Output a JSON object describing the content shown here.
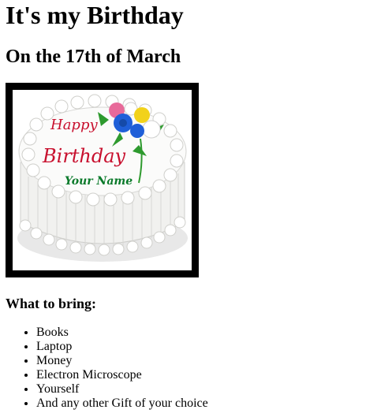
{
  "page": {
    "title": "It's my Birthday",
    "subtitle": "On the 17th of March",
    "image": {
      "alt": "Birthday cake",
      "cake_text_line1": "Happy",
      "cake_text_line2": "Birthday",
      "cake_text_line3": "Your Name",
      "colors": {
        "frame": "#000000",
        "icing": "#f4f4f2",
        "text_red": "#c8102e",
        "text_green": "#0a7a2a",
        "rose_blue": "#1f5fd8",
        "rose_pink": "#e86a9a",
        "rose_yellow": "#f2d21a",
        "rose_white": "#ffffff",
        "leaf": "#2e9a2e"
      }
    },
    "bring_heading": "What to bring:",
    "bring_items": [
      "Books",
      "Laptop",
      "Money",
      "Electron Microscope",
      "Yourself",
      "And any other Gift of your choice"
    ]
  }
}
